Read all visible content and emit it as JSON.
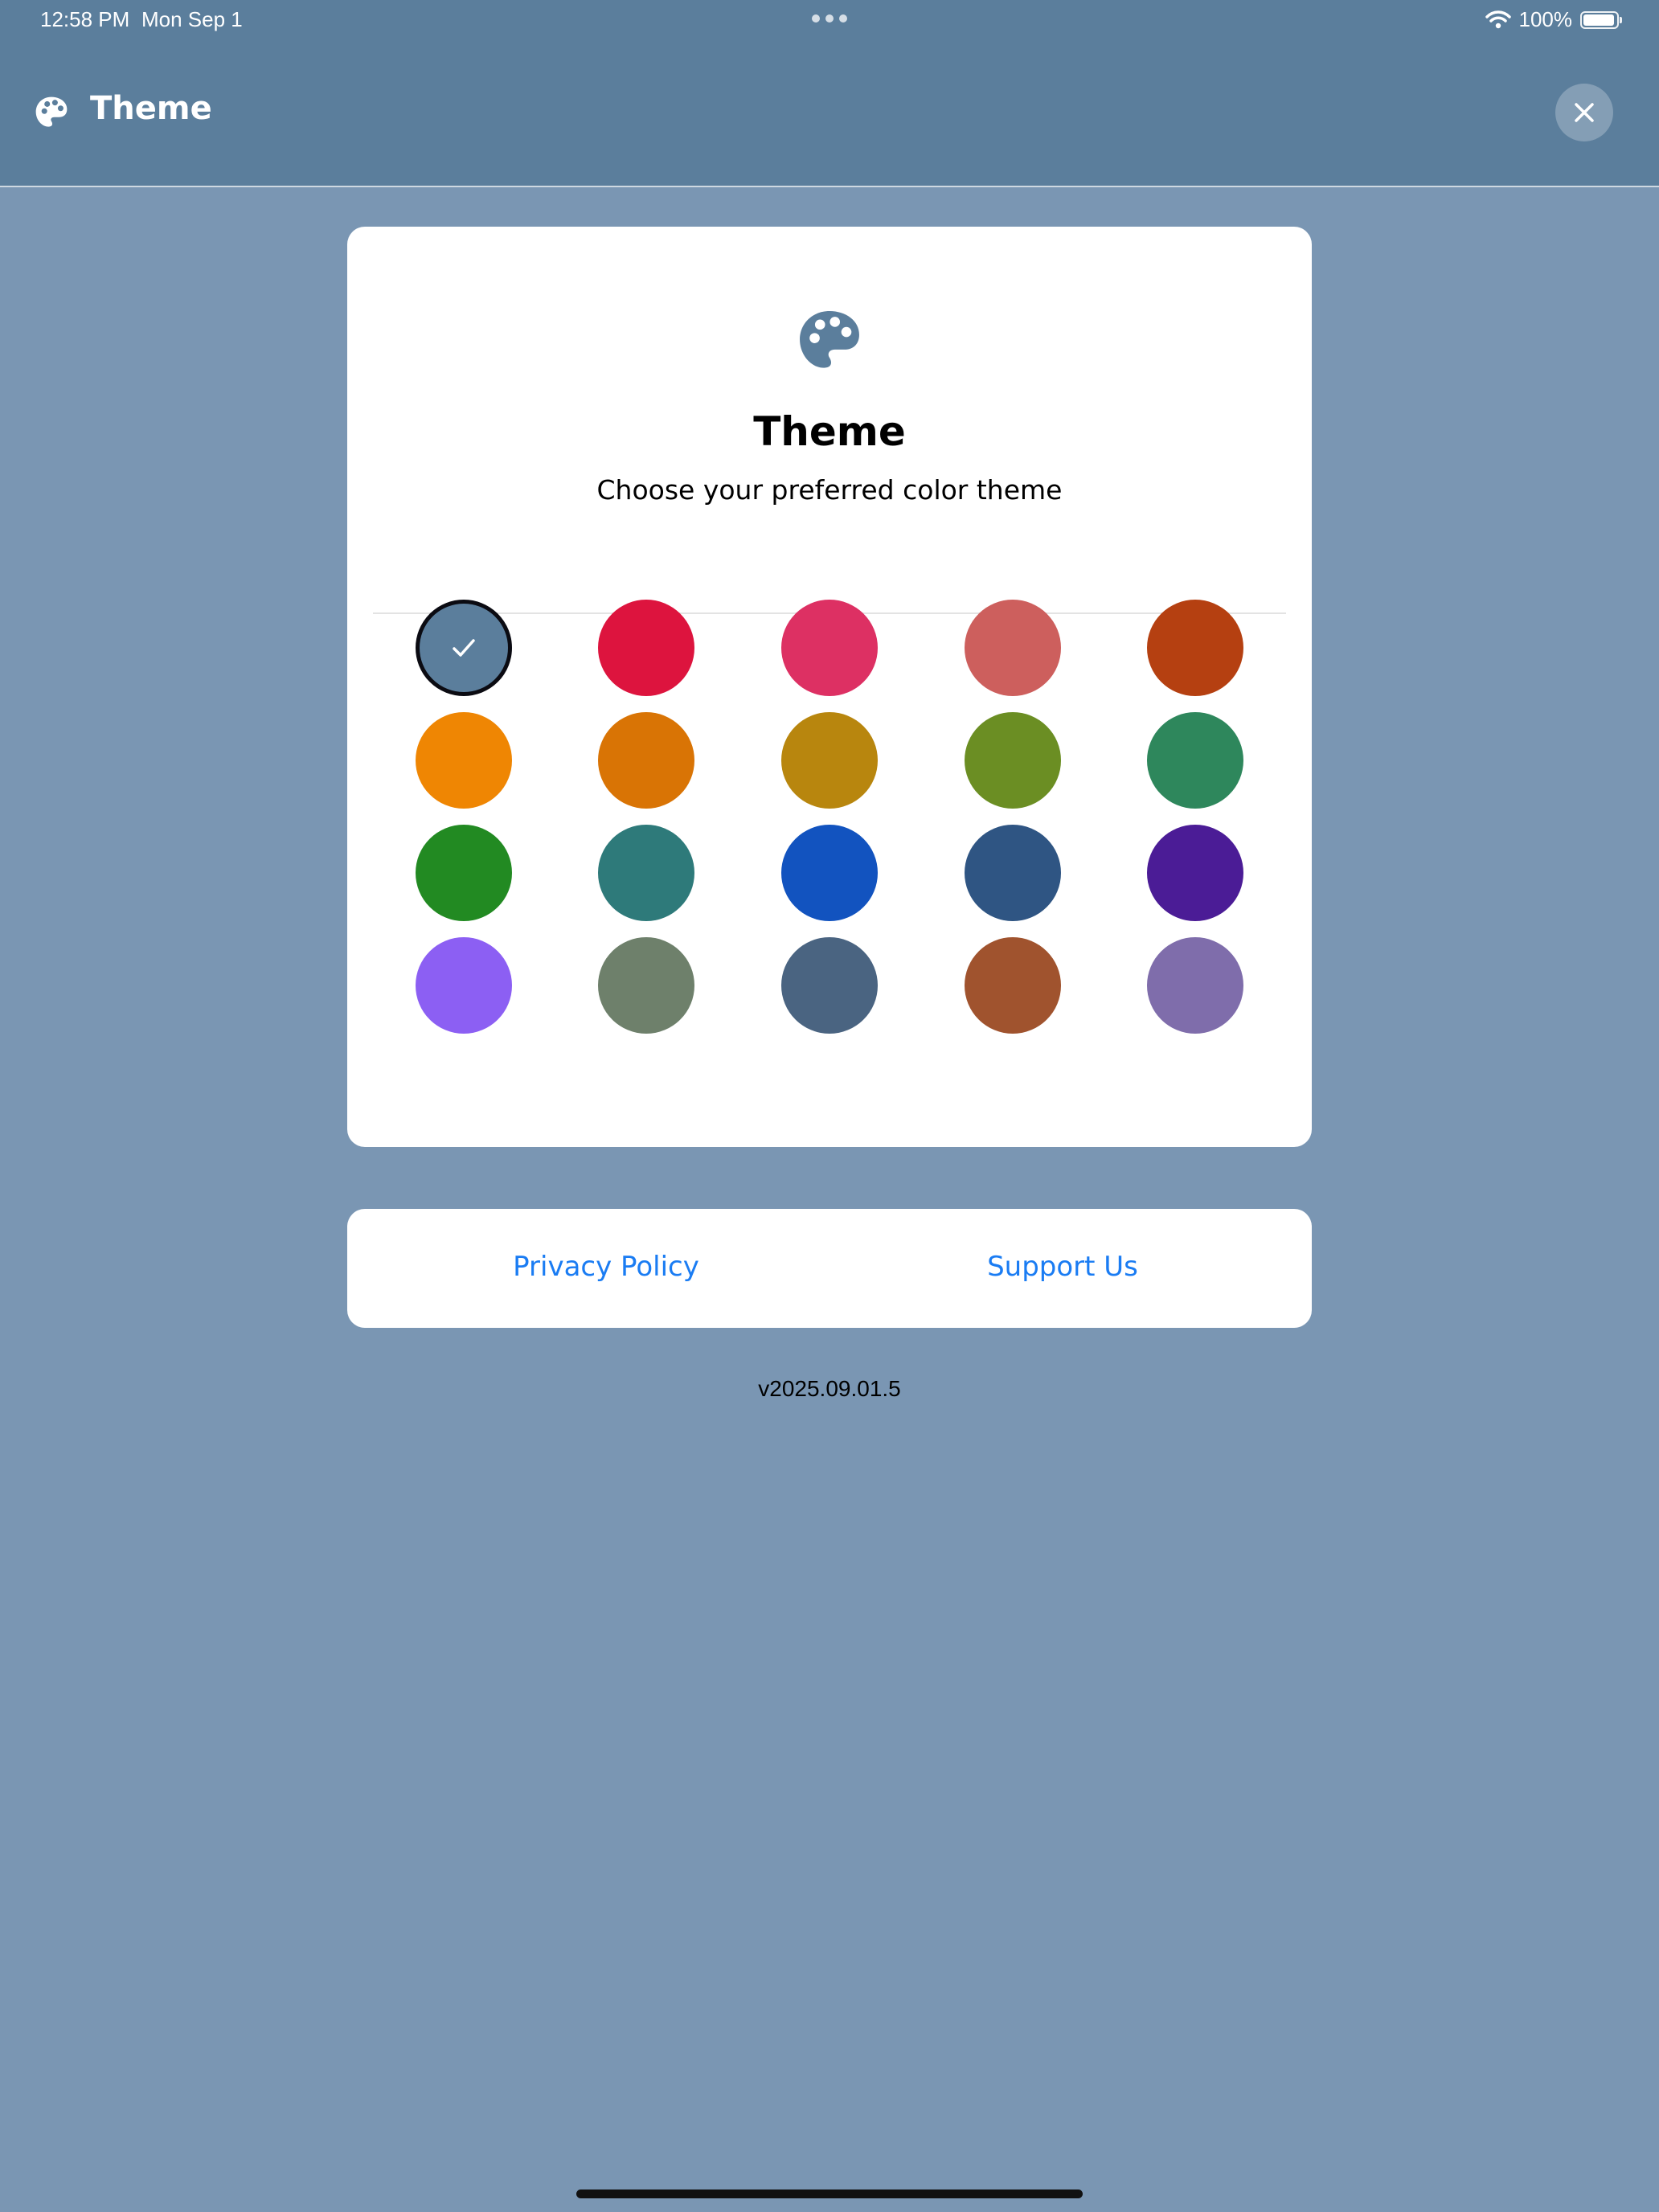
{
  "status_bar": {
    "time": "12:58 PM",
    "date": "Mon Sep 1",
    "battery": "100%"
  },
  "nav": {
    "title": "Theme",
    "icon": "palette-icon",
    "close_icon": "close-icon"
  },
  "card": {
    "icon": "palette-icon",
    "title": "Theme",
    "subtitle": "Choose your preferred color theme"
  },
  "themes": [
    {
      "color": "#5b7e9c",
      "selected": true
    },
    {
      "color": "#dd143e",
      "selected": false
    },
    {
      "color": "#dd3063",
      "selected": false
    },
    {
      "color": "#cd5f5d",
      "selected": false
    },
    {
      "color": "#b54011",
      "selected": false
    },
    {
      "color": "#ef8603",
      "selected": false
    },
    {
      "color": "#d97405",
      "selected": false
    },
    {
      "color": "#b8860e",
      "selected": false
    },
    {
      "color": "#6b8e23",
      "selected": false
    },
    {
      "color": "#2e875c",
      "selected": false
    },
    {
      "color": "#228a22",
      "selected": false
    },
    {
      "color": "#2e7a7a",
      "selected": false
    },
    {
      "color": "#1253bf",
      "selected": false
    },
    {
      "color": "#2f5583",
      "selected": false
    },
    {
      "color": "#4b1c96",
      "selected": false
    },
    {
      "color": "#8c5ff3",
      "selected": false
    },
    {
      "color": "#6e806b",
      "selected": false
    },
    {
      "color": "#4a6481",
      "selected": false
    },
    {
      "color": "#a0532e",
      "selected": false
    },
    {
      "color": "#7f6dab",
      "selected": false
    }
  ],
  "links": {
    "privacy": "Privacy Policy",
    "support": "Support Us"
  },
  "version": "v2025.09.01.5"
}
